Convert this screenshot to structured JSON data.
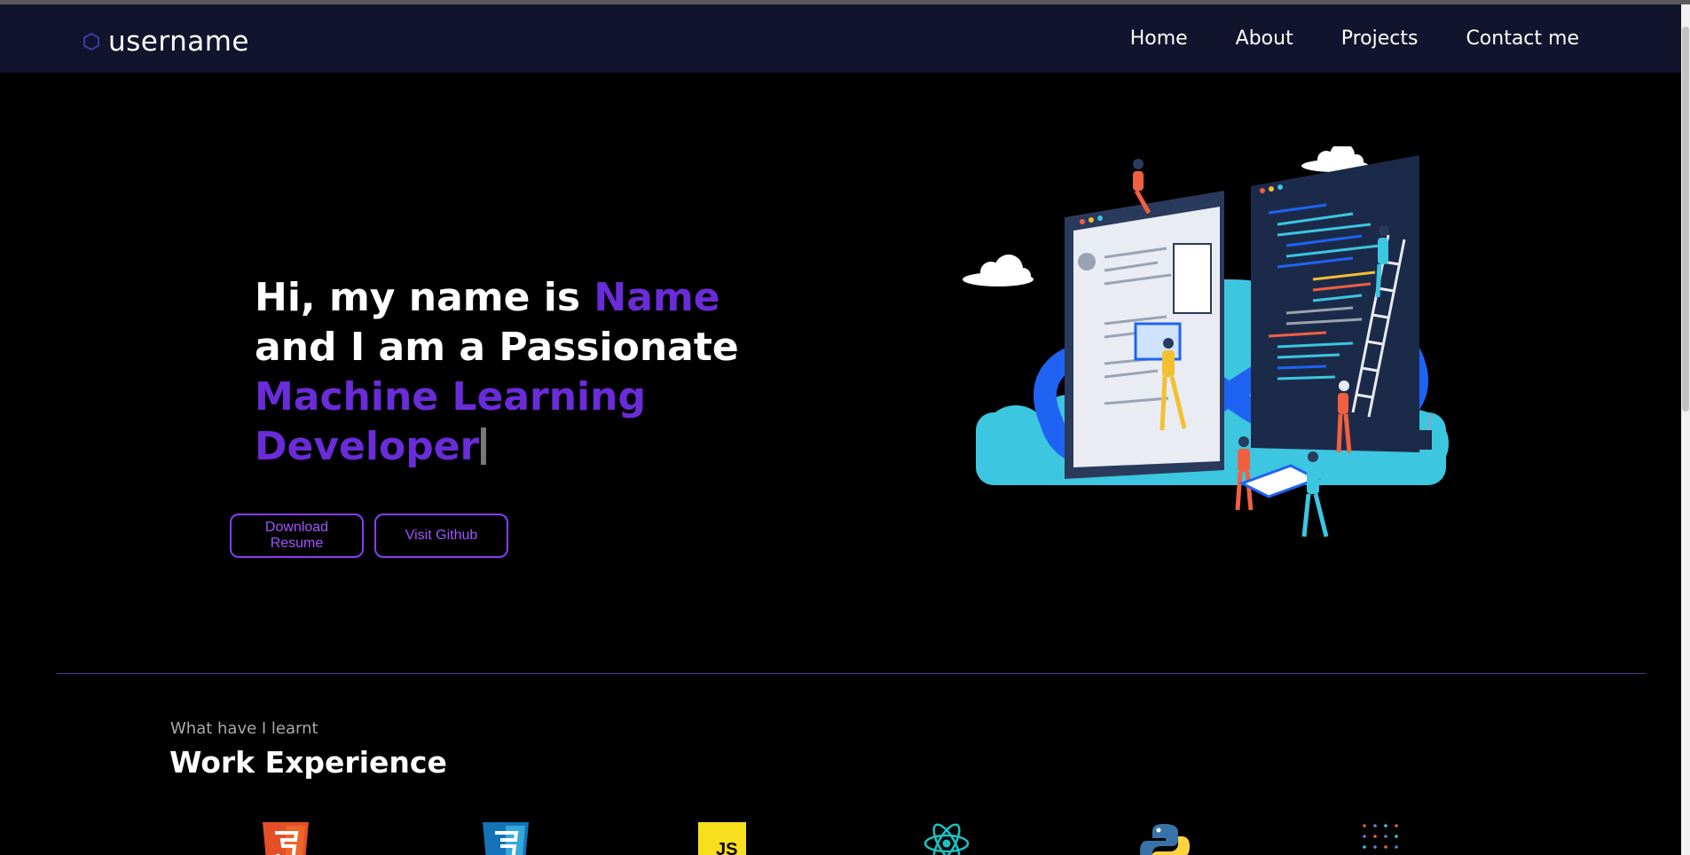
{
  "navbar": {
    "logo_text": "username",
    "links": [
      "Home",
      "About",
      "Projects",
      "Contact me"
    ]
  },
  "hero": {
    "line1_prefix": "Hi, my name is ",
    "line1_name": "Name",
    "line2": "and I am a Passionate",
    "role_line1": "Machine Learning",
    "role_line2": "Developer"
  },
  "buttons": {
    "resume": "Download Resume",
    "github": "Visit Github"
  },
  "experience": {
    "subtitle": "What have I learnt",
    "title": "Work Experience",
    "technologies": [
      {
        "name": "HTML5",
        "icon": "html5-icon"
      },
      {
        "name": "CSS3",
        "icon": "css3-icon"
      },
      {
        "name": "JavaScript",
        "icon": "javascript-icon",
        "label": "JS"
      },
      {
        "name": "React",
        "icon": "react-icon"
      },
      {
        "name": "Python",
        "icon": "python-icon"
      },
      {
        "name": "Dots",
        "icon": "dots-icon"
      }
    ]
  },
  "colors": {
    "accent": "#6a2bd8",
    "navbar": "#12132c",
    "button_border": "#8a3cf2"
  }
}
